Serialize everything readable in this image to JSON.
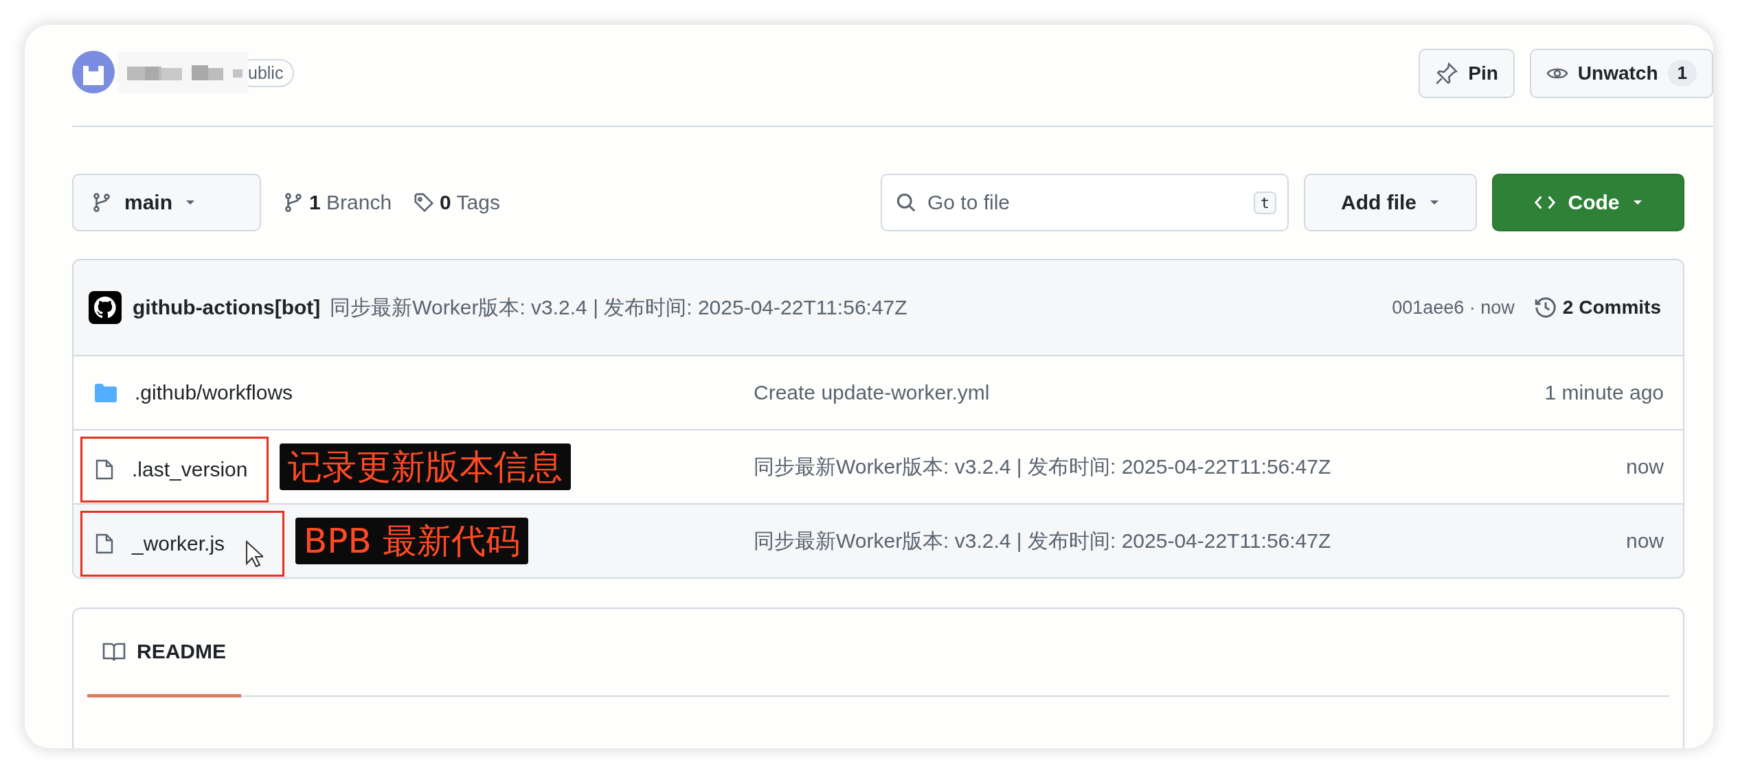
{
  "repo": {
    "visibility": "ublic"
  },
  "header_buttons": [
    {
      "kind": "pin",
      "label": "Pin"
    },
    {
      "kind": "watch",
      "label": "Unwatch",
      "count": "1"
    }
  ],
  "toolbar": {
    "branch": "main",
    "branches": "**1** Branch",
    "tags": "**0** Tags",
    "search": {
      "placeholder": "Go to file",
      "shortcut": "t"
    },
    "add_file": "Add file",
    "code": "Code"
  },
  "commit": {
    "author": "github-actions[bot]",
    "message": "同步最新Worker版本: v3.2.4 | 发布时间: 2025-04-22T11:56:47Z",
    "sha_time": "001aee6 · now",
    "commits": "2 Commits"
  },
  "files": [
    {
      "kind": "folder",
      "name": ".github/workflows",
      "message": "Create update-worker.yml",
      "time": "1 minute ago",
      "hovered": false
    },
    {
      "kind": "file",
      "name": ".last_version",
      "message": "同步最新Worker版本: v3.2.4 | 发布时间: 2025-04-22T11:56:47Z",
      "time": "now",
      "hovered": false,
      "annotation": "记录更新版本信息"
    },
    {
      "kind": "file",
      "name": "_worker.js",
      "message": "同步最新Worker版本: v3.2.4 | 发布时间: 2025-04-22T11:56:47Z",
      "time": "now",
      "hovered": true,
      "annotation": "BPB 最新代码"
    }
  ],
  "readme": {
    "label": "README",
    "selected": true
  }
}
